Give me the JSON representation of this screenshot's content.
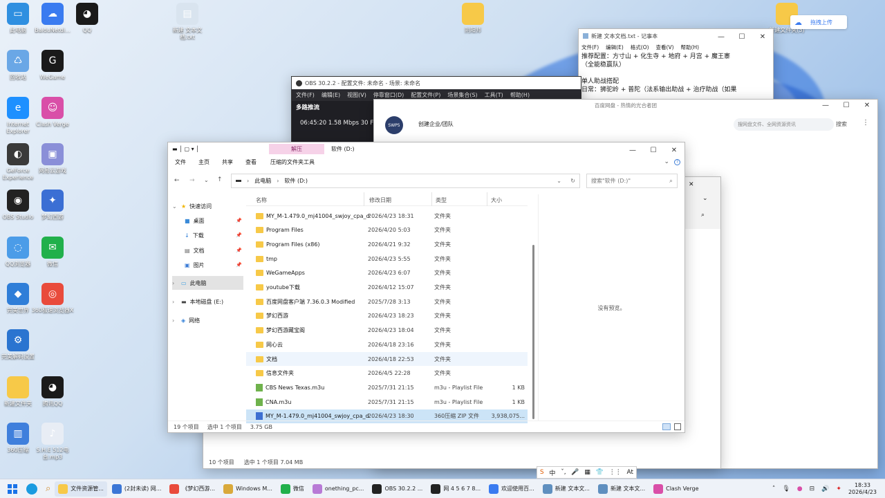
{
  "desktop": {
    "icons": [
      {
        "label": "此电脑",
        "color": "#2f8fe0",
        "glyph": "▭"
      },
      {
        "label": "BaiduNetdi...",
        "color": "#3a7bf0",
        "glyph": "☁"
      },
      {
        "label": "QQ",
        "color": "#1a1a1a",
        "glyph": "◕"
      },
      {
        "label": "回收站",
        "color": "#6aa7e6",
        "glyph": "♺"
      },
      {
        "label": "WeGame",
        "color": "#1a1a1a",
        "glyph": "G"
      },
      {
        "label": "Internet Explorer",
        "color": "#1e90ff",
        "glyph": "e"
      },
      {
        "label": "Clash Verge",
        "color": "#d94fa8",
        "glyph": "☺"
      },
      {
        "label": "GeForce Experience",
        "color": "#3a3a3a",
        "glyph": "◐"
      },
      {
        "label": "网易云游戏",
        "color": "#8a8fd8",
        "glyph": "▣"
      },
      {
        "label": "OBS Studio",
        "color": "#222",
        "glyph": "◉"
      },
      {
        "label": "梦幻西游",
        "color": "#3b6fd4",
        "glyph": "✦"
      },
      {
        "label": "QQ浏览器",
        "color": "#4b9ce8",
        "glyph": "◌"
      },
      {
        "label": "微信",
        "color": "#21b04b",
        "glyph": "✉"
      },
      {
        "label": "完美世界",
        "color": "#2f7ed8",
        "glyph": "◆"
      },
      {
        "label": "360极速浏览器X",
        "color": "#e94b3c",
        "glyph": "◎"
      },
      {
        "label": "完美解码设置",
        "color": "#2a74d0",
        "glyph": "⚙"
      },
      {
        "label": "新建文件夹",
        "color": "#f7c948",
        "glyph": ""
      },
      {
        "label": "腾讯QQ",
        "color": "#1a1a1a",
        "glyph": "◕"
      },
      {
        "label": "360压缩",
        "color": "#3f7fdc",
        "glyph": "▥"
      },
      {
        "label": "S.H.E 512电台.mp3",
        "color": "#e8edf5",
        "glyph": "♪"
      },
      {
        "label": "新建 文本文档.txt",
        "color": "#d9e4ef",
        "glyph": "▤"
      },
      {
        "label": "阴阳师",
        "color": "#f7c948",
        "glyph": ""
      },
      {
        "label": "新建文件夹(3)",
        "color": "#f7c948",
        "glyph": ""
      }
    ],
    "upload_button": "拖拽上传"
  },
  "notepad": {
    "title": "新建 文本文档.txt - 记事本",
    "menu": [
      "文件(F)",
      "编辑(E)",
      "格式(O)",
      "查看(V)",
      "帮助(H)"
    ],
    "lines": [
      "推荐配置：方寸山 + 化生寺 + 地府 + 月宫 + 魔王寨",
      "（全能稳赢队）",
      "",
      "单人助战搭配",
      "日常：狮驼岭 + 普陀（法系输出助战 + 治疗助战（如果"
    ]
  },
  "obs": {
    "title": "OBS 30.2.2 - 配置文件: 未命名 - 场景: 未命名",
    "menu": [
      "文件(F)",
      "编辑(E)",
      "视图(V)",
      "停靠窗口(D)",
      "配置文件(P)",
      "场景集合(S)",
      "工具(T)",
      "帮助(H)"
    ],
    "dock_title": "多路推流",
    "stats": "06:45:20  1.58 Mbps  30 FPS"
  },
  "baidu": {
    "title": "百度网盘 - 热情的光合者团",
    "enterprise": "创建企业/团队",
    "search_placeholder": "搜网盘文件、全网资源资讯",
    "search_btn": "搜索",
    "avatar_text": "SWP5"
  },
  "explorer": {
    "ribbon_tabs": [
      "文件",
      "主页",
      "共享",
      "查看"
    ],
    "context_tab": "解压",
    "context_tool": "压缩的文件夹工具",
    "window_title": "软件 (D:)",
    "breadcrumb": [
      "此电脑",
      "软件 (D:)"
    ],
    "search_placeholder": "搜索\"软件 (D:)\"",
    "columns": {
      "name": "名称",
      "date": "修改日期",
      "type": "类型",
      "size": "大小"
    },
    "nav": [
      {
        "label": "快速访问",
        "kind": "star"
      },
      {
        "label": "桌面",
        "kind": "desk"
      },
      {
        "label": "下载",
        "kind": "down"
      },
      {
        "label": "文档",
        "kind": "doc"
      },
      {
        "label": "图片",
        "kind": "pic"
      },
      {
        "label": "此电脑",
        "kind": "pc"
      },
      {
        "label": "本地磁盘 (E:)",
        "kind": "disk"
      },
      {
        "label": "网络",
        "kind": "net"
      }
    ],
    "files": [
      {
        "name": "MY_M-1.479.0_mj41004_swjoy_cpa_dev",
        "date": "2026/4/23 18:31",
        "type": "文件夹",
        "size": "",
        "icon": "folder"
      },
      {
        "name": "Program Files",
        "date": "2026/4/20 5:03",
        "type": "文件夹",
        "size": "",
        "icon": "folder"
      },
      {
        "name": "Program Files (x86)",
        "date": "2026/4/21 9:32",
        "type": "文件夹",
        "size": "",
        "icon": "folder"
      },
      {
        "name": "tmp",
        "date": "2026/4/23 5:55",
        "type": "文件夹",
        "size": "",
        "icon": "folder"
      },
      {
        "name": "WeGameApps",
        "date": "2026/4/23 6:07",
        "type": "文件夹",
        "size": "",
        "icon": "folder"
      },
      {
        "name": "youtube下载",
        "date": "2026/4/12 15:07",
        "type": "文件夹",
        "size": "",
        "icon": "folder"
      },
      {
        "name": "百度网盘客户端 7.36.0.3 Modified",
        "date": "2025/7/28 3:13",
        "type": "文件夹",
        "size": "",
        "icon": "folder"
      },
      {
        "name": "梦幻西游",
        "date": "2026/4/23 18:23",
        "type": "文件夹",
        "size": "",
        "icon": "folder"
      },
      {
        "name": "梦幻西游藏宝阁",
        "date": "2026/4/23 18:04",
        "type": "文件夹",
        "size": "",
        "icon": "folder"
      },
      {
        "name": "网心云",
        "date": "2026/4/18 23:16",
        "type": "文件夹",
        "size": "",
        "icon": "folder"
      },
      {
        "name": "文档",
        "date": "2026/4/18 22:53",
        "type": "文件夹",
        "size": "",
        "icon": "folder"
      },
      {
        "name": "信息文件夹",
        "date": "2026/4/5 22:28",
        "type": "文件夹",
        "size": "",
        "icon": "folder"
      },
      {
        "name": "CBS News Texas.m3u",
        "date": "2025/7/31 21:15",
        "type": "m3u - Playlist File",
        "size": "1 KB",
        "icon": "file"
      },
      {
        "name": "CNA.m3u",
        "date": "2025/7/31 21:15",
        "type": "m3u - Playlist File",
        "size": "1 KB",
        "icon": "file"
      },
      {
        "name": "MY_M-1.479.0_mj41004_swjoy_cpa_d...",
        "date": "2026/4/23 18:30",
        "type": "360压缩 ZIP 文件",
        "size": "3,938,075...",
        "icon": "zip"
      }
    ],
    "preview_text": "没有预览。",
    "status_count": "19 个项目",
    "status_selected": "选中 1 个项目",
    "status_size": "3.75 GB"
  },
  "explorer_back": {
    "status_count": "10 个项目",
    "status_selected": "选中 1 个项目  7.04 MB"
  },
  "ime": {
    "items": [
      "S",
      "中",
      "ˇ,",
      "🎤",
      "▦",
      "👕",
      "⋮⋮",
      "At"
    ]
  },
  "taskbar": {
    "apps": [
      {
        "label": "文件资源管...",
        "color": "#f7c948"
      },
      {
        "label": "(2封未读) 网...",
        "color": "#3b76d6"
      },
      {
        "label": "《梦幻西游...",
        "color": "#e94b3c"
      },
      {
        "label": "Windows M...",
        "color": "#d9a93b"
      },
      {
        "label": "微信",
        "color": "#21b04b"
      },
      {
        "label": "onething_pc...",
        "color": "#b87ad6"
      },
      {
        "label": "OBS 30.2.2 ...",
        "color": "#222"
      },
      {
        "label": "网 4 5 6 7 8...",
        "color": "#222"
      },
      {
        "label": "欢迎使用百...",
        "color": "#3a7bf0"
      },
      {
        "label": "新建 文本文...",
        "color": "#5f8fbf"
      },
      {
        "label": "新建 文本文...",
        "color": "#5f8fbf"
      },
      {
        "label": "Clash Verge",
        "color": "#d94fa8"
      }
    ],
    "time": "18:33",
    "date": "2026/4/23"
  }
}
